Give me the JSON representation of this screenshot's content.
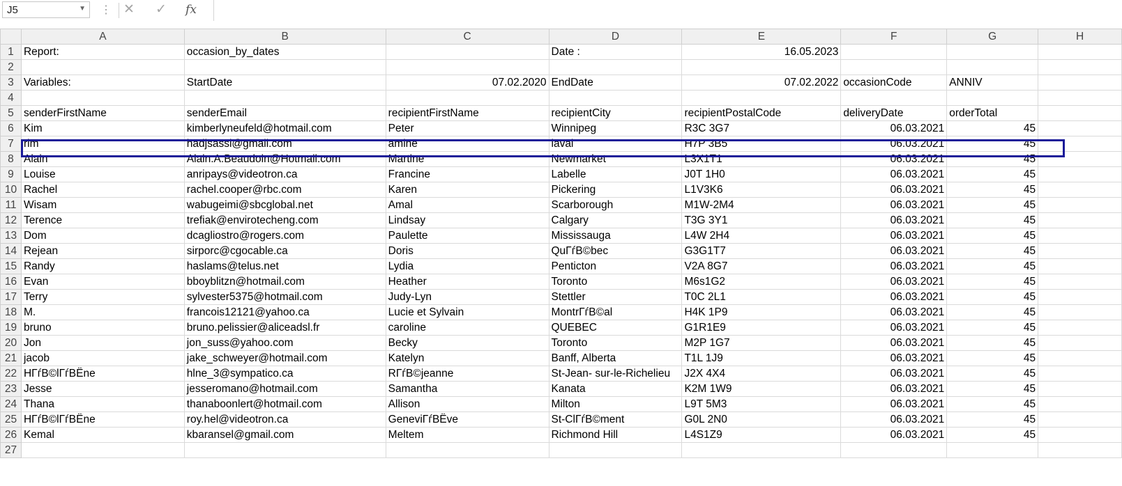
{
  "formula_bar": {
    "name_box": "J5",
    "cancel_icon": "✕",
    "enter_icon": "✓",
    "fx_label": "fx",
    "content": ""
  },
  "columns": [
    "A",
    "B",
    "C",
    "D",
    "E",
    "F",
    "G",
    "H"
  ],
  "rows": [
    {
      "n": "1",
      "c": [
        "Report:",
        " occasion_by_dates",
        "",
        " Date :",
        "16.05.2023",
        "",
        "",
        ""
      ]
    },
    {
      "n": "2",
      "c": [
        "",
        "",
        "",
        "",
        "",
        "",
        "",
        ""
      ]
    },
    {
      "n": "3",
      "c": [
        "Variables:",
        " StartDate",
        "07.02.2020",
        "EndDate",
        "07.02.2022",
        "occasionCode",
        "ANNIV",
        ""
      ]
    },
    {
      "n": "4",
      "c": [
        "",
        "",
        "",
        "",
        "",
        "",
        "",
        ""
      ]
    },
    {
      "n": "5",
      "c": [
        "senderFirstName",
        "senderEmail",
        "recipientFirstName",
        "recipientCity",
        "recipientPostalCode",
        "deliveryDate",
        "orderTotal",
        ""
      ]
    },
    {
      "n": "6",
      "c": [
        "Kim",
        "kimberlyneufeld@hotmail.com",
        "Peter",
        "Winnipeg",
        "R3C 3G7",
        "06.03.2021",
        "45",
        ""
      ]
    },
    {
      "n": "7",
      "c": [
        "rim",
        "hadjsassi@gmail.com",
        "amine",
        "laval",
        "H7P 3B5",
        "06.03.2021",
        "45",
        ""
      ]
    },
    {
      "n": "8",
      "c": [
        "Alain",
        "Alain.A.Beaudoin@Hotmail.com",
        "Martine",
        "Newmarket",
        "L3X1T1",
        "06.03.2021",
        "45",
        ""
      ]
    },
    {
      "n": "9",
      "c": [
        "Louise",
        "anripays@videotron.ca",
        "Francine",
        "Labelle",
        "J0T 1H0",
        "06.03.2021",
        "45",
        ""
      ]
    },
    {
      "n": "10",
      "c": [
        "Rachel",
        "rachel.cooper@rbc.com",
        "Karen",
        "Pickering",
        "L1V3K6",
        "06.03.2021",
        "45",
        ""
      ]
    },
    {
      "n": "11",
      "c": [
        "Wisam",
        "wabugeimi@sbcglobal.net",
        "Amal",
        "Scarborough",
        "M1W-2M4",
        "06.03.2021",
        "45",
        ""
      ]
    },
    {
      "n": "12",
      "c": [
        "Terence",
        "trefiak@envirotecheng.com",
        "Lindsay",
        "Calgary",
        "T3G 3Y1",
        "06.03.2021",
        "45",
        ""
      ]
    },
    {
      "n": "13",
      "c": [
        "Dom",
        "dcagliostro@rogers.com",
        "Paulette",
        "Mississauga",
        "L4W 2H4",
        "06.03.2021",
        "45",
        ""
      ]
    },
    {
      "n": "14",
      "c": [
        " Rejean",
        "sirporc@cgocable.ca",
        "Doris",
        "QuΓѓВ©bec",
        "G3G1T7",
        "06.03.2021",
        "45",
        ""
      ]
    },
    {
      "n": "15",
      "c": [
        "Randy",
        "haslams@telus.net",
        "Lydia",
        "Penticton",
        "V2A 8G7",
        "06.03.2021",
        "45",
        ""
      ]
    },
    {
      "n": "16",
      "c": [
        "Evan",
        "bboyblitzn@hotmail.com",
        "Heather",
        "Toronto",
        "M6s1G2",
        "06.03.2021",
        "45",
        ""
      ]
    },
    {
      "n": "17",
      "c": [
        "Terry",
        "sylvester5375@hotmail.com",
        "Judy-Lyn",
        "Stettler",
        "T0C 2L1",
        "06.03.2021",
        "45",
        ""
      ]
    },
    {
      "n": "18",
      "c": [
        "M.",
        "francois12121@yahoo.ca",
        "Lucie et Sylvain",
        "MontrΓѓВ©al",
        "H4K 1P9",
        "06.03.2021",
        "45",
        ""
      ]
    },
    {
      "n": "19",
      "c": [
        "bruno",
        "bruno.pelissier@aliceadsl.fr",
        "caroline",
        "QUEBEC",
        "G1R1E9",
        "06.03.2021",
        "45",
        ""
      ]
    },
    {
      "n": "20",
      "c": [
        "Jon",
        "jon_suss@yahoo.com",
        "Becky",
        "Toronto",
        "M2P 1G7",
        "06.03.2021",
        "45",
        ""
      ]
    },
    {
      "n": "21",
      "c": [
        "jacob",
        "jake_schweyer@hotmail.com",
        "Katelyn",
        "Banff, Alberta",
        "T1L 1J9",
        "06.03.2021",
        "45",
        ""
      ]
    },
    {
      "n": "22",
      "c": [
        "HΓѓВ©lΓѓВЁne",
        "hlne_3@sympatico.ca",
        "RΓѓВ©jeanne",
        "St-Jean- sur-le-Richelieu",
        "J2X 4X4",
        "06.03.2021",
        "45",
        ""
      ]
    },
    {
      "n": "23",
      "c": [
        "Jesse",
        "jesseromano@hotmail.com",
        "Samantha",
        "Kanata",
        "K2M 1W9",
        "06.03.2021",
        "45",
        ""
      ]
    },
    {
      "n": "24",
      "c": [
        "Thana",
        "thanaboonlert@hotmail.com",
        "Allison",
        "Milton",
        "L9T 5M3",
        "06.03.2021",
        "45",
        ""
      ]
    },
    {
      "n": "25",
      "c": [
        "HΓѓВ©lΓѓВЁne",
        "roy.hel@videotron.ca",
        "GeneviΓѓВЁve",
        "St-ClΓѓВ©ment",
        "G0L 2N0",
        "06.03.2021",
        "45",
        ""
      ]
    },
    {
      "n": "26",
      "c": [
        "Kemal",
        "kbaransel@gmail.com",
        "Meltem",
        "Richmond Hill",
        "L4S1Z9",
        "06.03.2021",
        "45",
        ""
      ]
    },
    {
      "n": "27",
      "c": [
        "",
        "",
        "",
        "",
        "",
        "",
        "",
        ""
      ]
    }
  ],
  "right_aligned": {
    "1": [
      4
    ],
    "3": [
      2,
      4
    ],
    "data": [
      5,
      6
    ]
  },
  "selection_row": "5"
}
